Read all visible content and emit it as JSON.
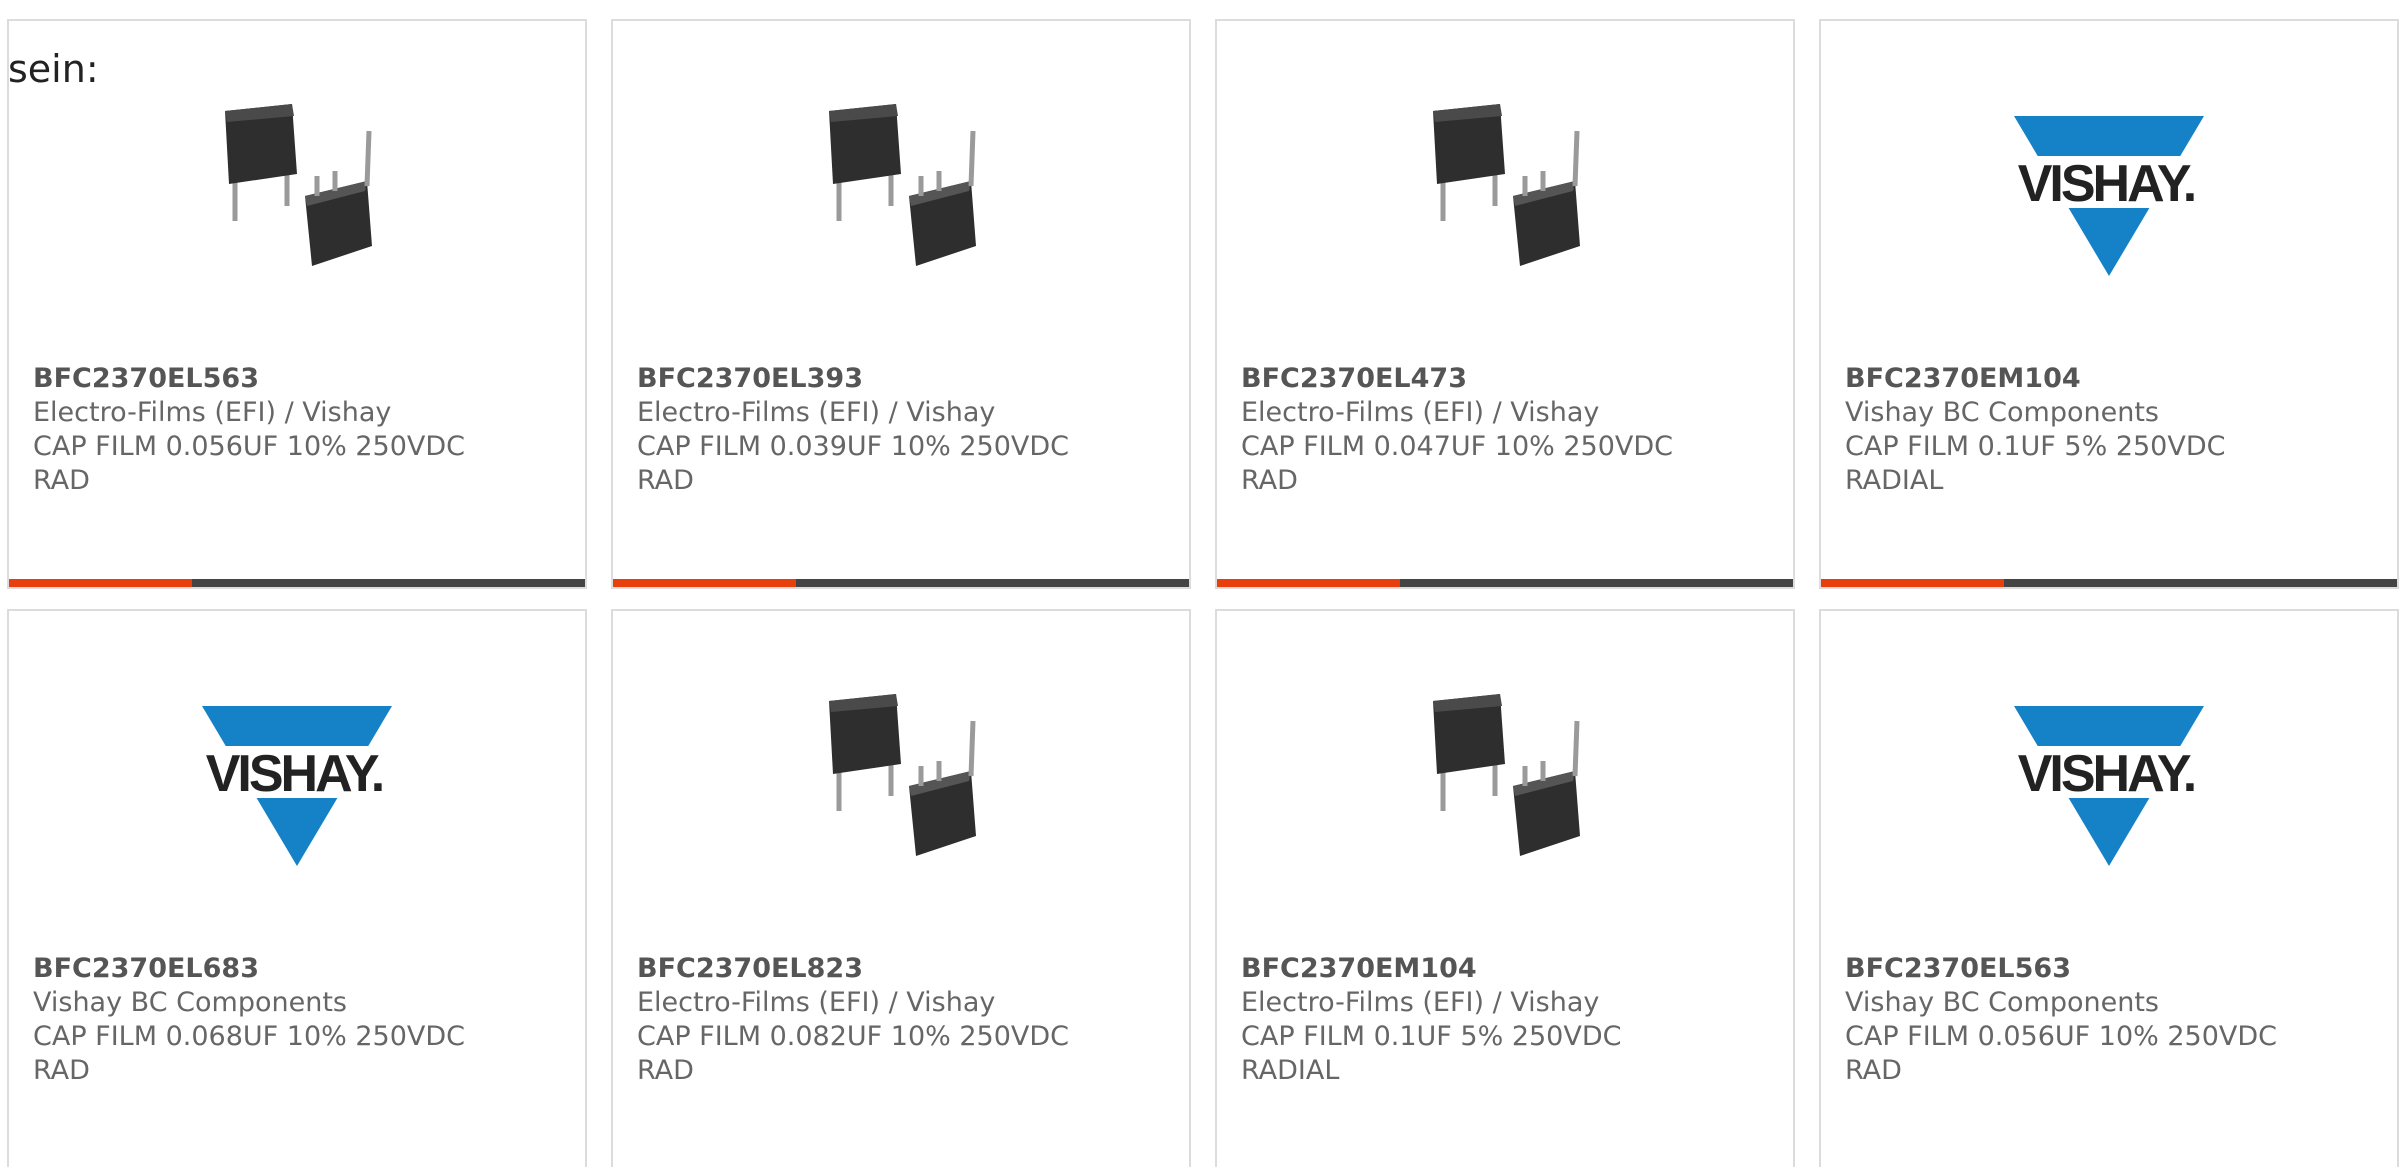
{
  "intro": "sein:",
  "colors": {
    "accent": "#e8400c",
    "bar": "#444444",
    "vishay_blue": "#1581c6",
    "text": "#666666"
  },
  "cards": [
    {
      "part": "BFC2370EL563",
      "maker": "Electro-Films (EFI) / Vishay",
      "desc": "CAP FILM 0.056UF 10% 250VDC",
      "pkg": "RAD",
      "image": "capacitor-image"
    },
    {
      "part": "BFC2370EL393",
      "maker": "Electro-Films (EFI) / Vishay",
      "desc": "CAP FILM 0.039UF 10% 250VDC",
      "pkg": "RAD",
      "image": "capacitor-image"
    },
    {
      "part": "BFC2370EL473",
      "maker": "Electro-Films (EFI) / Vishay",
      "desc": "CAP FILM 0.047UF 10% 250VDC",
      "pkg": "RAD",
      "image": "capacitor-image"
    },
    {
      "part": "BFC2370EM104",
      "maker": "Vishay BC Components",
      "desc": "CAP FILM 0.1UF 5% 250VDC",
      "pkg": "RADIAL",
      "image": "vishay-logo",
      "logo_text": "VISHAY."
    },
    {
      "part": "BFC2370EL683",
      "maker": "Vishay BC Components",
      "desc": "CAP FILM 0.068UF 10% 250VDC",
      "pkg": "RAD",
      "image": "vishay-logo",
      "logo_text": "VISHAY."
    },
    {
      "part": "BFC2370EL823",
      "maker": "Electro-Films (EFI) / Vishay",
      "desc": "CAP FILM 0.082UF 10% 250VDC",
      "pkg": "RAD",
      "image": "capacitor-image"
    },
    {
      "part": "BFC2370EM104",
      "maker": "Electro-Films (EFI) / Vishay",
      "desc": "CAP FILM 0.1UF 5% 250VDC",
      "pkg": "RADIAL",
      "image": "capacitor-image"
    },
    {
      "part": "BFC2370EL563",
      "maker": "Vishay BC Components",
      "desc": "CAP FILM 0.056UF 10% 250VDC",
      "pkg": "RAD",
      "image": "vishay-logo",
      "logo_text": "VISHAY."
    }
  ]
}
